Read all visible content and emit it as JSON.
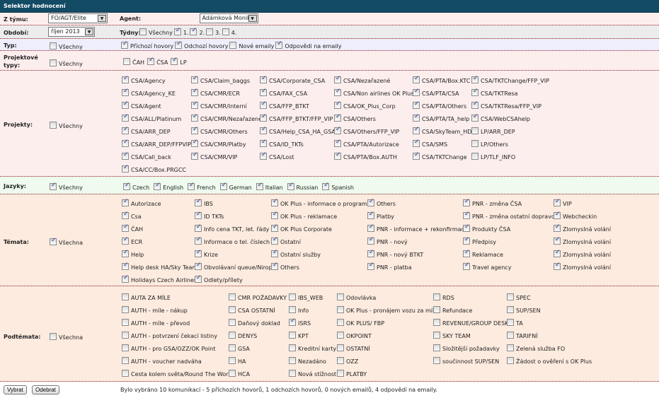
{
  "title": "Selektor hodnocení",
  "team": {
    "label": "Z týmu:",
    "value": "FO/AGT/Elite"
  },
  "agent": {
    "label": "Agent:",
    "value": "Adámková Monika"
  },
  "period": {
    "label": "Období:",
    "value": "říjen 2013"
  },
  "weeks": {
    "label": "Týdny:",
    "items": [
      {
        "label": "Všechny",
        "checked": false
      },
      {
        "label": "1.",
        "checked": true
      },
      {
        "label": "2.",
        "checked": true
      },
      {
        "label": "3.",
        "checked": false
      },
      {
        "label": "4.",
        "checked": false
      }
    ]
  },
  "type": {
    "label": "Typ:",
    "all": {
      "label": "Všechny",
      "checked": false
    },
    "items": [
      {
        "label": "Příchozí hovory",
        "checked": true
      },
      {
        "label": "Odchozí hovory",
        "checked": true
      },
      {
        "label": "Nové emaily",
        "checked": false
      },
      {
        "label": "Odpovědi na emaily",
        "checked": true
      }
    ]
  },
  "project_types": {
    "label": "Projektové typy:",
    "all": {
      "label": "Všechny",
      "checked": false
    },
    "items": [
      {
        "label": "ČAH",
        "checked": false
      },
      {
        "label": "ČSA",
        "checked": true
      },
      {
        "label": "LP",
        "checked": true
      }
    ]
  },
  "projects": {
    "label": "Projekty:",
    "all": {
      "label": "Všechny",
      "checked": false
    },
    "columns": [
      [
        {
          "label": "CSA/Agency",
          "checked": true
        },
        {
          "label": "CSA/Agency_KE",
          "checked": true
        },
        {
          "label": "CSA/Agent",
          "checked": true
        },
        {
          "label": "CSA/ALL/Platinum",
          "checked": true
        },
        {
          "label": "CSA/ARR_DEP",
          "checked": true
        },
        {
          "label": "CSA/ARR_DEP/FFPVIP",
          "checked": true
        },
        {
          "label": "CSA/Call_back",
          "checked": true
        },
        {
          "label": "CSA/CC/Box.PRGCC",
          "checked": true
        }
      ],
      [
        {
          "label": "CSA/Claim_baggs",
          "checked": true
        },
        {
          "label": "CSA/CMR/ECR",
          "checked": true
        },
        {
          "label": "CSA/CMR/Interní",
          "checked": true
        },
        {
          "label": "CSA/CMR/Nezařazené",
          "checked": true
        },
        {
          "label": "CSA/CMR/Others",
          "checked": true
        },
        {
          "label": "CSA/CMR/Platby",
          "checked": true
        },
        {
          "label": "CSA/CMR/VIP",
          "checked": true
        }
      ],
      [
        {
          "label": "CSA/Corporate_CSA",
          "checked": true
        },
        {
          "label": "CSA/FAX_CSA",
          "checked": true
        },
        {
          "label": "CSA/FFP_BTKT",
          "checked": true
        },
        {
          "label": "CSA/FFP_BTKT/FFP_VIP",
          "checked": true
        },
        {
          "label": "CSA/Help_CSA_HA_GSA",
          "checked": true
        },
        {
          "label": "CSA/ID_TKTs",
          "checked": true
        },
        {
          "label": "CSA/Lost",
          "checked": true
        }
      ],
      [
        {
          "label": "CSA/Nezařazené",
          "checked": true
        },
        {
          "label": "CSA/Non airlines OK Plus",
          "checked": true
        },
        {
          "label": "CSA/OK_Plus_Corp",
          "checked": true
        },
        {
          "label": "CSA/Others",
          "checked": true
        },
        {
          "label": "CSA/Others/FFP_VIP",
          "checked": true
        },
        {
          "label": "CSA/PTA/Autorizace",
          "checked": true
        },
        {
          "label": "CSA/PTA/Box.AUTH",
          "checked": true
        }
      ],
      [
        {
          "label": "CSA/PTA/Box.KTC",
          "checked": true
        },
        {
          "label": "CSA/PTA/CSA",
          "checked": true
        },
        {
          "label": "CSA/PTA/Others",
          "checked": true
        },
        {
          "label": "CSA/PTA/TA_help",
          "checked": true
        },
        {
          "label": "CSA/SkyTeam_HD",
          "checked": true
        },
        {
          "label": "CSA/SMS",
          "checked": true
        },
        {
          "label": "CSA/TKTChange",
          "checked": true
        }
      ],
      [
        {
          "label": "CSA/TKTChange/FFP_VIP",
          "checked": true
        },
        {
          "label": "CSA/TKTResa",
          "checked": true
        },
        {
          "label": "CSA/TKTResa/FFP_VIP",
          "checked": true
        },
        {
          "label": "CSA/WebCSAhelp",
          "checked": true
        },
        {
          "label": "LP/ARR_DEP",
          "checked": false
        },
        {
          "label": "LP/Others",
          "checked": false
        },
        {
          "label": "LP/TLF_INFO",
          "checked": false
        }
      ]
    ]
  },
  "languages": {
    "label": "Jazyky:",
    "all": {
      "label": "Všechny",
      "checked": true
    },
    "items": [
      {
        "label": "Czech",
        "checked": true
      },
      {
        "label": "English",
        "checked": true
      },
      {
        "label": "French",
        "checked": true
      },
      {
        "label": "German",
        "checked": true
      },
      {
        "label": "Italian",
        "checked": true
      },
      {
        "label": "Russian",
        "checked": true
      },
      {
        "label": "Spanish",
        "checked": true
      }
    ]
  },
  "themes": {
    "label": "Témata:",
    "all": {
      "label": "Všechna",
      "checked": true
    },
    "columns": [
      [
        {
          "label": "Autorizace",
          "checked": true
        },
        {
          "label": "Csa",
          "checked": true
        },
        {
          "label": "ČAH",
          "checked": true
        },
        {
          "label": "ECR",
          "checked": true
        },
        {
          "label": "Help",
          "checked": true
        },
        {
          "label": "Help desk HA/Sky Team",
          "checked": true
        },
        {
          "label": "Holidays Czech Airlines",
          "checked": true
        }
      ],
      [
        {
          "label": "IBS",
          "checked": true
        },
        {
          "label": "ID TKTs",
          "checked": true
        },
        {
          "label": "Info cena TKT, let. řády",
          "checked": true
        },
        {
          "label": "Informace o tel. číslech",
          "checked": true
        },
        {
          "label": "Krize",
          "checked": true
        },
        {
          "label": "Obvolávaní queue/Nirop",
          "checked": true
        },
        {
          "label": "Odlety/přílety",
          "checked": true
        }
      ],
      [
        {
          "label": "OK Plus - informace o programu",
          "checked": true
        },
        {
          "label": "OK Plus - reklamace",
          "checked": true
        },
        {
          "label": "OK Plus Corporate",
          "checked": true
        },
        {
          "label": "Ostatní",
          "checked": true
        },
        {
          "label": "Ostatní služby",
          "checked": true
        },
        {
          "label": "Others",
          "checked": true
        }
      ],
      [
        {
          "label": "Others",
          "checked": true
        },
        {
          "label": "Platby",
          "checked": true
        },
        {
          "label": "PNR - informace + rekonfirmace",
          "checked": true
        },
        {
          "label": "PNR - nový",
          "checked": true
        },
        {
          "label": "PNR - nový BTKT",
          "checked": true
        },
        {
          "label": "PNR - platba",
          "checked": true
        }
      ],
      [
        {
          "label": "PNR - změna ČSA",
          "checked": true
        },
        {
          "label": "PNR - změna ostatní dopravci",
          "checked": true
        },
        {
          "label": "Produkty ČSA",
          "checked": true
        },
        {
          "label": "Předpisy",
          "checked": true
        },
        {
          "label": "Reklamace",
          "checked": true
        },
        {
          "label": "Travel agency",
          "checked": true
        }
      ],
      [
        {
          "label": "VIP",
          "checked": true
        },
        {
          "label": "Webcheckin",
          "checked": true
        },
        {
          "label": "Zlomyslná volání",
          "checked": true
        },
        {
          "label": "Zlomyslná volání",
          "checked": true
        },
        {
          "label": "Zlomyslná volání",
          "checked": true
        },
        {
          "label": "Zlomyslná volání",
          "checked": true
        }
      ]
    ]
  },
  "subthemes": {
    "label": "Podtémata:",
    "all": {
      "label": "Všechna",
      "checked": false
    },
    "columns": [
      [
        {
          "label": "AUTA ZA MÍLE",
          "checked": false
        },
        {
          "label": "AUTH - míle - nákup",
          "checked": false
        },
        {
          "label": "AUTH - míle - převod",
          "checked": false
        },
        {
          "label": "AUTH - potvrzení čekací listiny",
          "checked": false
        },
        {
          "label": "AUTH - pro GSA/OZZ/OK Point",
          "checked": false
        },
        {
          "label": "AUTH - voucher nadváha",
          "checked": false
        },
        {
          "label": "Cesta kolem světa/Round The World",
          "checked": false
        }
      ],
      [
        {
          "label": "CMR POŽADAVKY",
          "checked": false
        },
        {
          "label": "CSA OSTATNÍ",
          "checked": false
        },
        {
          "label": "Daňový doklad",
          "checked": false
        },
        {
          "label": "DENYS",
          "checked": false
        },
        {
          "label": "GSA",
          "checked": false
        },
        {
          "label": "HA",
          "checked": false
        },
        {
          "label": "HCA",
          "checked": false
        }
      ],
      [
        {
          "label": "IBS_WEB",
          "checked": false
        },
        {
          "label": "Info",
          "checked": false
        },
        {
          "label": "ISRS",
          "checked": true
        },
        {
          "label": "KPT",
          "checked": false
        },
        {
          "label": "Kreditní karty",
          "checked": false
        },
        {
          "label": "Nezadáno",
          "checked": false
        },
        {
          "label": "Nová stížnost",
          "checked": false
        }
      ],
      [
        {
          "label": "Odovlávka",
          "checked": false
        },
        {
          "label": "OK Plus - pronájem vozu za míle",
          "checked": false
        },
        {
          "label": "OK PLUS/ FBP",
          "checked": false
        },
        {
          "label": "OKPOINT",
          "checked": false
        },
        {
          "label": "OSTATNÍ",
          "checked": false
        },
        {
          "label": "OZZ",
          "checked": false
        },
        {
          "label": "PLATBY",
          "checked": false
        }
      ],
      [
        {
          "label": "RDS",
          "checked": false
        },
        {
          "label": "Refundace",
          "checked": false
        },
        {
          "label": "REVENUE/GROUP DESK",
          "checked": false
        },
        {
          "label": "SKY TEAM",
          "checked": false
        },
        {
          "label": "Složitější požadavky",
          "checked": false
        },
        {
          "label": "součinnost SUP/SEN",
          "checked": false
        }
      ],
      [
        {
          "label": "SPEC",
          "checked": false
        },
        {
          "label": "SUP/SEN",
          "checked": false
        },
        {
          "label": "TA",
          "checked": false
        },
        {
          "label": "TARIFNÍ",
          "checked": false
        },
        {
          "label": "Zelená služba FO",
          "checked": false
        },
        {
          "label": "Žádost o ověření s OK Plus",
          "checked": false
        }
      ]
    ]
  },
  "footer": {
    "select_label": "Vybrat",
    "remove_label": "Odebrat",
    "summary": "Bylo vybráno 10 komunikací - 5 příchozích hovorů, 1 odchozích hovorů, 0 nových emailů, 4 odpovědí na emaily."
  },
  "colors": {
    "header": "#134a64",
    "pink": "#fdeeee",
    "gray": "#ececec",
    "lavender": "#eeeefc",
    "green": "#eefbee",
    "peach": "#fdebdf"
  }
}
